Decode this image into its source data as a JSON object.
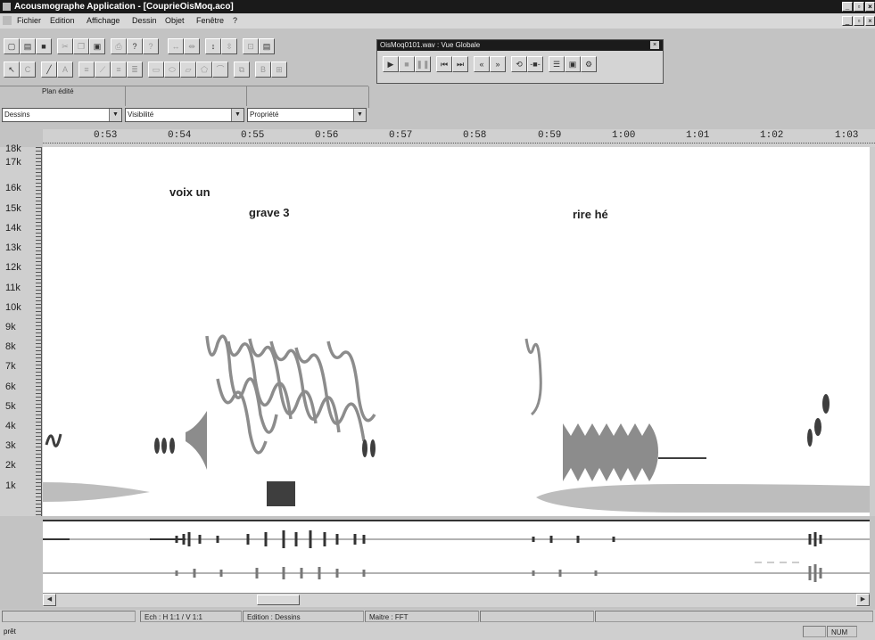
{
  "window": {
    "title": "Acousmographe Application - [CouprieOisMoq.aco]"
  },
  "menu": [
    "Fichier",
    "Edition",
    "Affichage",
    "Dessin",
    "Objet",
    "Fenêtre",
    "?"
  ],
  "plan_edite": "Plan édité",
  "selects": {
    "dessins": "Dessins",
    "visibilite": "Visibilité",
    "propriete": "Propriété"
  },
  "player": {
    "title": "OisMoq0101.wav : Vue Globale"
  },
  "ruler_labels": [
    "0:53",
    "0:54",
    "0:55",
    "0:56",
    "0:57",
    "0:58",
    "0:59",
    "1:00",
    "1:01",
    "1:02",
    "1:03"
  ],
  "y_labels": [
    "18k",
    "17k",
    "16k",
    "15k",
    "14k",
    "13k",
    "12k",
    "11k",
    "10k",
    "9k",
    "8k",
    "7k",
    "6k",
    "5k",
    "4k",
    "3k",
    "2k",
    "1k"
  ],
  "annotations": {
    "voix_un": "voix un",
    "grave3": "grave 3",
    "rire_he": "rire hé"
  },
  "status": {
    "ech": "Ech : H 1:1 / V 1:1",
    "edition": "Edition : Dessins",
    "maitre": "Maitre : FFT"
  },
  "bottom": {
    "left": "prêt",
    "num": "NUM"
  },
  "colors": {
    "shape_dark": "#3e3e3e",
    "shape_mid": "#8c8c8c",
    "shape_light": "#bdbdbd"
  }
}
